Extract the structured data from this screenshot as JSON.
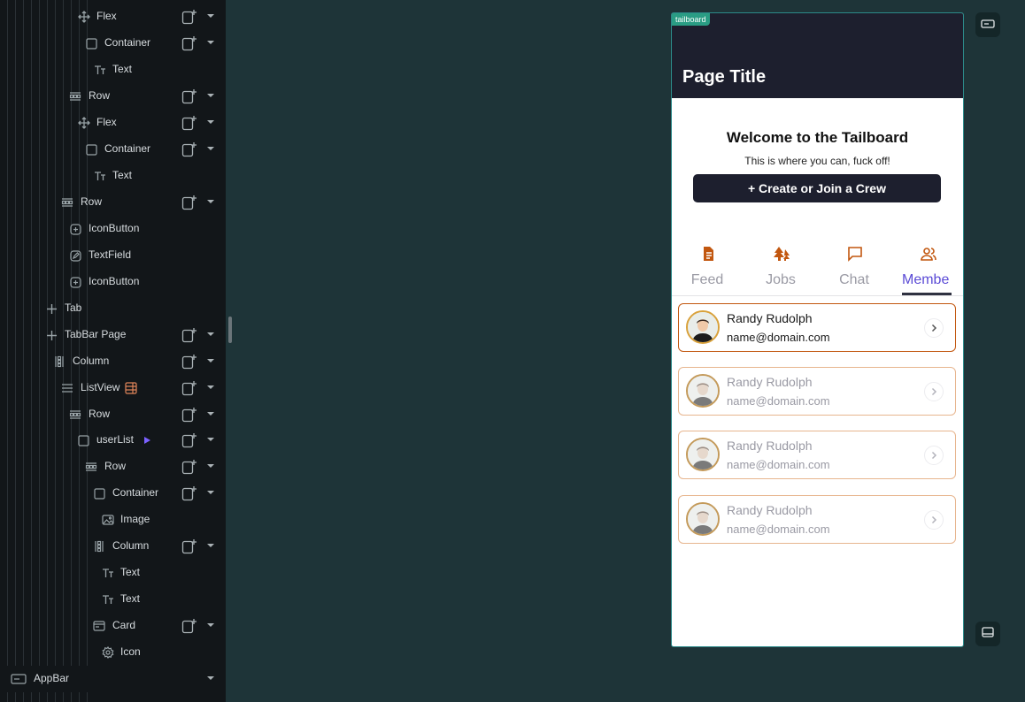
{
  "tree": {
    "items": [
      {
        "label": "Flex",
        "icon": "flex-icon",
        "add": true,
        "caret": true
      },
      {
        "label": "Container",
        "icon": "container-icon",
        "add": true,
        "caret": true
      },
      {
        "label": "Text",
        "icon": "text-icon",
        "add": false,
        "caret": false
      },
      {
        "label": "Row",
        "icon": "row-icon",
        "add": true,
        "caret": true
      },
      {
        "label": "Flex",
        "icon": "flex-icon",
        "add": true,
        "caret": true
      },
      {
        "label": "Container",
        "icon": "container-icon",
        "add": true,
        "caret": true
      },
      {
        "label": "Text",
        "icon": "text-icon",
        "add": false,
        "caret": false
      },
      {
        "label": "Row",
        "icon": "row-icon",
        "add": true,
        "caret": true
      },
      {
        "label": "IconButton",
        "icon": "icon-button-icon",
        "add": false,
        "caret": false
      },
      {
        "label": "TextField",
        "icon": "textfield-icon",
        "add": false,
        "caret": false
      },
      {
        "label": "IconButton",
        "icon": "icon-button-icon",
        "add": false,
        "caret": false
      },
      {
        "label": "Tab",
        "icon": "plus-icon",
        "add": false,
        "caret": false
      },
      {
        "label": "TabBar Page",
        "icon": "plus-icon",
        "add": true,
        "caret": true
      },
      {
        "label": "Column",
        "icon": "column-icon",
        "add": true,
        "caret": true
      },
      {
        "label": "ListView",
        "icon": "listview-icon",
        "add": true,
        "caret": true
      },
      {
        "label": "Row",
        "icon": "row-icon",
        "add": true,
        "caret": true
      },
      {
        "label": "userList",
        "icon": "container-icon",
        "add": true,
        "caret": true
      },
      {
        "label": "Row",
        "icon": "row-icon",
        "add": true,
        "caret": true
      },
      {
        "label": "Container",
        "icon": "container-icon",
        "add": true,
        "caret": true
      },
      {
        "label": "Image",
        "icon": "image-icon",
        "add": false,
        "caret": false
      },
      {
        "label": "Column",
        "icon": "column-icon",
        "add": true,
        "caret": true
      },
      {
        "label": "Text",
        "icon": "text-icon",
        "add": false,
        "caret": false
      },
      {
        "label": "Text",
        "icon": "text-icon",
        "add": false,
        "caret": false
      },
      {
        "label": "Card",
        "icon": "card-icon",
        "add": true,
        "caret": true
      },
      {
        "label": "Icon",
        "icon": "gear-icon",
        "add": false,
        "caret": false
      },
      {
        "label": "AppBar",
        "icon": "appbar-icon",
        "add": false,
        "caret": true
      }
    ]
  },
  "preview": {
    "badge": "tailboard",
    "page_title": "Page Title",
    "welcome": "Welcome to the Tailboard",
    "subtitle": "This is where you can, fuck off!",
    "crew_button": "+ Create or Join a Crew",
    "tabs": [
      {
        "label": "Feed",
        "icon": "document-icon"
      },
      {
        "label": "Jobs",
        "icon": "trees-icon"
      },
      {
        "label": "Chat",
        "icon": "chat-icon"
      },
      {
        "label": "Membe",
        "icon": "people-icon"
      }
    ],
    "members": [
      {
        "name": "Randy Rudolph",
        "email": "name@domain.com"
      },
      {
        "name": "Randy Rudolph",
        "email": "name@domain.com"
      },
      {
        "name": "Randy Rudolph",
        "email": "name@domain.com"
      },
      {
        "name": "Randy Rudolph",
        "email": "name@domain.com"
      }
    ]
  },
  "colors": {
    "canvas_bg": "#1e3438",
    "tree_bg": "#121619",
    "accent_orange": "#c2570f",
    "tab_active": "#5b4bd6",
    "teal_badge": "#2a9d84"
  }
}
